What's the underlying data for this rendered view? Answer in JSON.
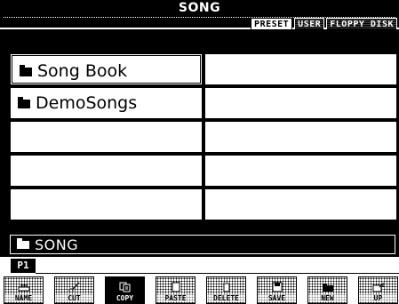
{
  "header": {
    "title": "SONG"
  },
  "tabs": [
    {
      "label": "PRESET",
      "active": true
    },
    {
      "label": "USER",
      "active": false
    },
    {
      "label": "FLOPPY DISK",
      "active": false
    }
  ],
  "files": [
    {
      "name": "Song Book",
      "type": "folder",
      "selected": true
    },
    {
      "name": "",
      "type": "empty"
    },
    {
      "name": "DemoSongs",
      "type": "folder",
      "selected": false
    },
    {
      "name": "",
      "type": "empty"
    },
    {
      "name": "",
      "type": "empty"
    },
    {
      "name": "",
      "type": "empty"
    },
    {
      "name": "",
      "type": "empty"
    },
    {
      "name": "",
      "type": "empty"
    },
    {
      "name": "",
      "type": "empty"
    },
    {
      "name": "",
      "type": "empty"
    }
  ],
  "path": {
    "label": "SONG"
  },
  "page": {
    "label": "P1"
  },
  "buttons": [
    {
      "label": "NAME",
      "icon": "name-icon",
      "enabled": false
    },
    {
      "label": "CUT",
      "icon": "cut-icon",
      "enabled": false
    },
    {
      "label": "COPY",
      "icon": "copy-icon",
      "enabled": true
    },
    {
      "label": "PASTE",
      "icon": "paste-icon",
      "enabled": false
    },
    {
      "label": "DELETE",
      "icon": "delete-icon",
      "enabled": false
    },
    {
      "label": "SAVE",
      "icon": "save-icon",
      "enabled": false
    },
    {
      "label": "NEW",
      "icon": "new-folder-icon",
      "enabled": false
    },
    {
      "label": "UP",
      "icon": "up-icon",
      "enabled": false
    }
  ],
  "colors": {
    "background": "#000000",
    "foreground": "#ffffff"
  }
}
